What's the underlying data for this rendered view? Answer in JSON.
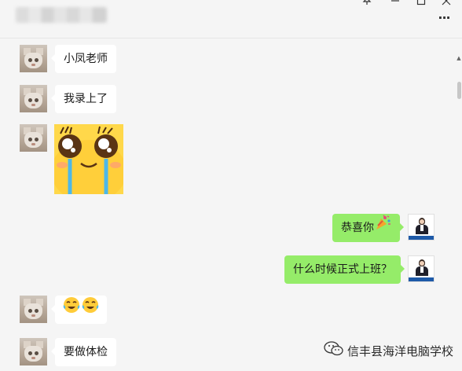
{
  "window": {
    "title_obscured": true,
    "controls": {
      "pin": "pin-icon",
      "minimize": "minimize-icon",
      "maximize": "maximize-icon",
      "close": "close-icon"
    },
    "more_label": "···"
  },
  "messages": [
    {
      "side": "left",
      "type": "text",
      "text": "小凤老师"
    },
    {
      "side": "left",
      "type": "text",
      "text": "我录上了"
    },
    {
      "side": "left",
      "type": "sticker",
      "sticker": "crying-happy-face-sticker"
    },
    {
      "side": "right",
      "type": "text",
      "text": "恭喜你",
      "emoji": "party-popper-emoji"
    },
    {
      "side": "right",
      "type": "text",
      "text": "什么时候正式上班？"
    },
    {
      "side": "left",
      "type": "emoji",
      "emoji": [
        "tears-of-joy-emoji",
        "tears-of-joy-emoji"
      ],
      "text": "😂😂"
    },
    {
      "side": "left",
      "type": "text",
      "text": "要做体检"
    }
  ],
  "watermark": {
    "text": "信丰县海洋电脑学校",
    "icon": "wechat-icon"
  },
  "colors": {
    "background": "#f5f5f5",
    "bubble_self": "#95ec69",
    "bubble_other": "#ffffff",
    "sticker_bg": "#ffd84a"
  }
}
